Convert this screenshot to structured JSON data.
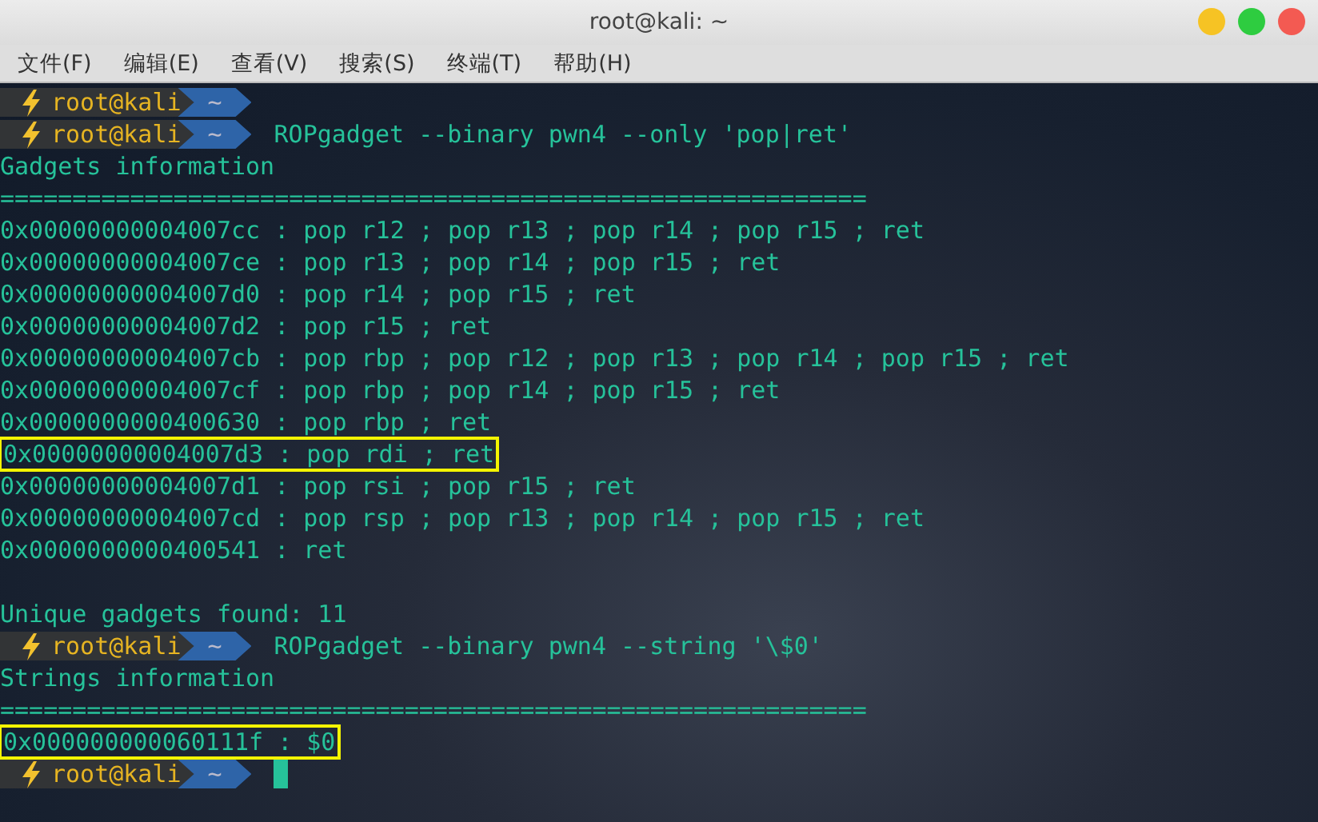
{
  "window": {
    "title": "root@kali: ~"
  },
  "menu": [
    "文件(F)",
    "编辑(E)",
    "查看(V)",
    "搜索(S)",
    "终端(T)",
    "帮助(H)"
  ],
  "lines": [
    {
      "kind": "prompt",
      "user": "root@kali",
      "dir": "~",
      "cursor": false
    },
    {
      "kind": "prompt",
      "user": "root@kali",
      "dir": "~",
      "command": "ROPgadget --binary pwn4 --only 'pop|ret'",
      "cursor": false
    },
    {
      "kind": "text",
      "text": "Gadgets information",
      "highlighted": false
    },
    {
      "kind": "text",
      "text": "============================================================",
      "highlighted": false
    },
    {
      "kind": "text",
      "text": "0x00000000004007cc : pop r12 ; pop r13 ; pop r14 ; pop r15 ; ret",
      "highlighted": false
    },
    {
      "kind": "text",
      "text": "0x00000000004007ce : pop r13 ; pop r14 ; pop r15 ; ret",
      "highlighted": false
    },
    {
      "kind": "text",
      "text": "0x00000000004007d0 : pop r14 ; pop r15 ; ret",
      "highlighted": false
    },
    {
      "kind": "text",
      "text": "0x00000000004007d2 : pop r15 ; ret",
      "highlighted": false
    },
    {
      "kind": "text",
      "text": "0x00000000004007cb : pop rbp ; pop r12 ; pop r13 ; pop r14 ; pop r15 ; ret",
      "highlighted": false
    },
    {
      "kind": "text",
      "text": "0x00000000004007cf : pop rbp ; pop r14 ; pop r15 ; ret",
      "highlighted": false
    },
    {
      "kind": "text",
      "text": "0x0000000000400630 : pop rbp ; ret",
      "highlighted": false
    },
    {
      "kind": "text",
      "text": "0x00000000004007d3 : pop rdi ; ret",
      "highlighted": true
    },
    {
      "kind": "text",
      "text": "0x00000000004007d1 : pop rsi ; pop r15 ; ret",
      "highlighted": false
    },
    {
      "kind": "text",
      "text": "0x00000000004007cd : pop rsp ; pop r13 ; pop r14 ; pop r15 ; ret",
      "highlighted": false
    },
    {
      "kind": "text",
      "text": "0x0000000000400541 : ret",
      "highlighted": false
    },
    {
      "kind": "blank"
    },
    {
      "kind": "text",
      "text": "Unique gadgets found: 11",
      "highlighted": false
    },
    {
      "kind": "prompt",
      "user": "root@kali",
      "dir": "~",
      "command": "ROPgadget --binary pwn4 --string '\\$0'",
      "cursor": false
    },
    {
      "kind": "text",
      "text": "Strings information",
      "highlighted": false
    },
    {
      "kind": "text",
      "text": "============================================================",
      "highlighted": false
    },
    {
      "kind": "text",
      "text": "0x000000000060111f : $0",
      "highlighted": true
    },
    {
      "kind": "prompt",
      "user": "root@kali",
      "dir": "~",
      "cursor": true
    }
  ]
}
